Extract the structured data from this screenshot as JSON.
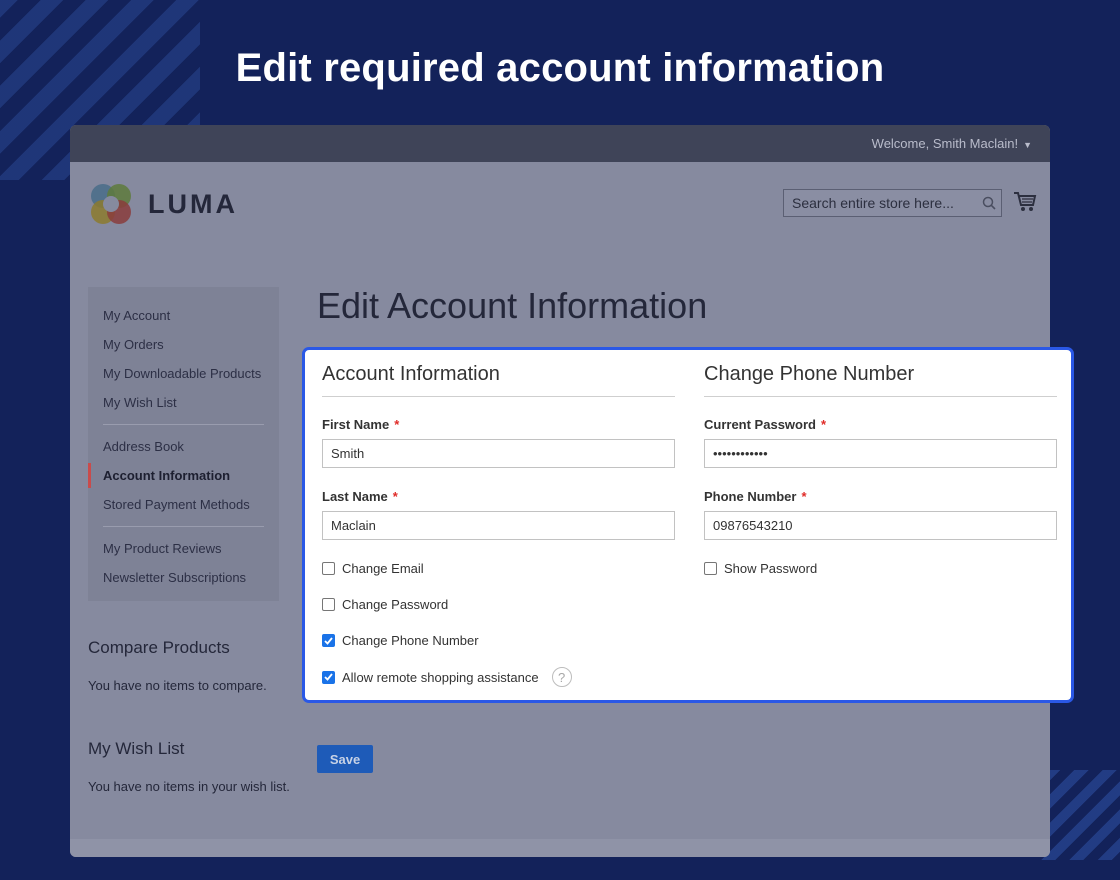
{
  "hero": {
    "title": "Edit required account information"
  },
  "topbar": {
    "welcome": "Welcome, Smith Maclain!"
  },
  "header": {
    "logo_text": "LUMA",
    "search_placeholder": "Search entire store here...",
    "icons": {
      "search": "search-icon",
      "cart": "cart-icon"
    }
  },
  "sidebar": {
    "items": [
      {
        "label": "My Account"
      },
      {
        "label": "My Orders"
      },
      {
        "label": "My Downloadable Products"
      },
      {
        "label": "My Wish List"
      },
      {
        "label": "Address Book"
      },
      {
        "label": "Account Information",
        "active": true
      },
      {
        "label": "Stored Payment Methods"
      },
      {
        "label": "My Product Reviews"
      },
      {
        "label": "Newsletter Subscriptions"
      }
    ]
  },
  "compare": {
    "title": "Compare Products",
    "empty": "You have no items to compare."
  },
  "wishlist": {
    "title": "My Wish List",
    "empty": "You have no items in your wish list."
  },
  "main": {
    "title": "Edit Account Information",
    "save_label": "Save"
  },
  "account_info": {
    "title": "Account Information",
    "first_name": {
      "label": "First Name",
      "required": "*",
      "value": "Smith"
    },
    "last_name": {
      "label": "Last Name",
      "required": "*",
      "value": "Maclain"
    },
    "checkboxes": [
      {
        "label": "Change Email",
        "checked": false
      },
      {
        "label": "Change Password",
        "checked": false
      },
      {
        "label": "Change Phone Number",
        "checked": true
      },
      {
        "label": "Allow remote shopping assistance",
        "checked": true
      }
    ],
    "help_icon": "question-circle-icon"
  },
  "change_phone": {
    "title": "Change Phone Number",
    "current_password": {
      "label": "Current Password",
      "required": "*",
      "value": "••••••••••••"
    },
    "phone_number": {
      "label": "Phone Number",
      "required": "*",
      "value": "09876543210"
    },
    "show_password": {
      "label": "Show Password",
      "checked": false
    }
  },
  "colors": {
    "background": "#13225a",
    "card_border": "#2a58e6",
    "save_button": "#1e5bb8",
    "checkbox_checked": "#1a73e8",
    "required": "#e02b27"
  }
}
